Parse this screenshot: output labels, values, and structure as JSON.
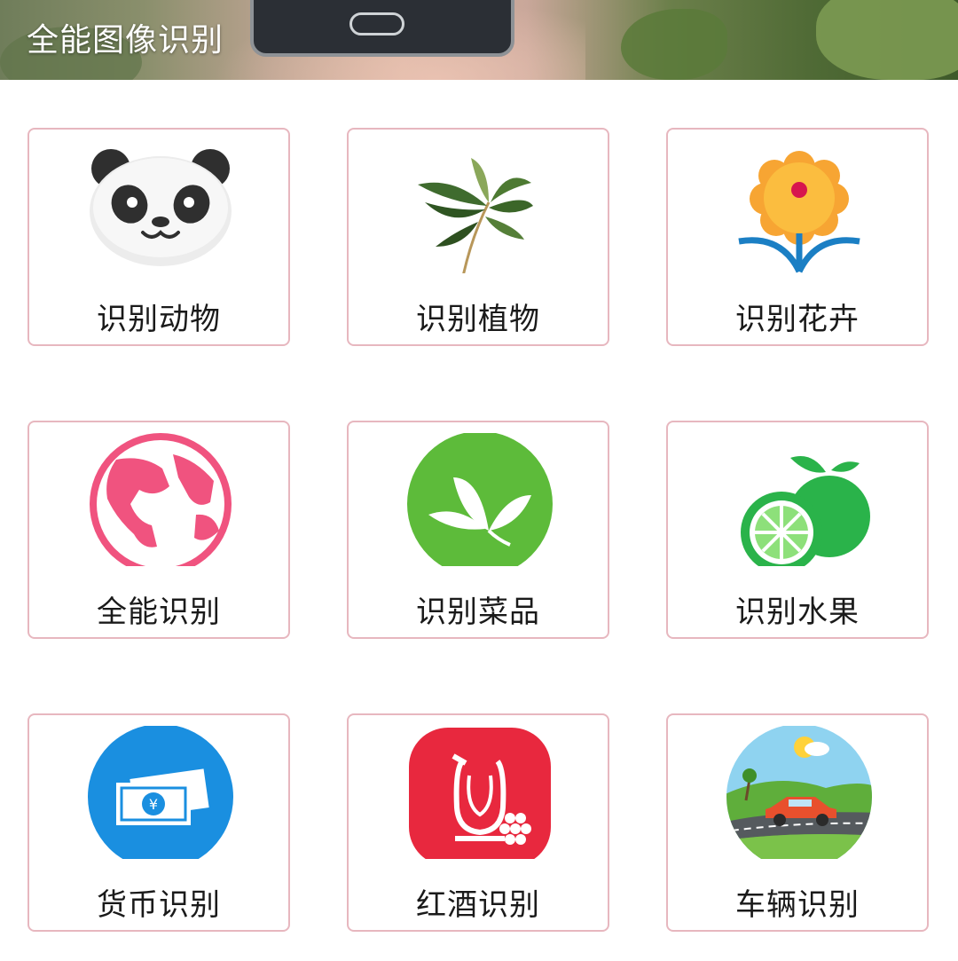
{
  "banner": {
    "title": "全能图像识别"
  },
  "cards": [
    {
      "label": "识别动物",
      "icon": "panda-icon"
    },
    {
      "label": "识别植物",
      "icon": "leaf-branch-icon"
    },
    {
      "label": "识别花卉",
      "icon": "flower-icon"
    },
    {
      "label": "全能识别",
      "icon": "globe-icon"
    },
    {
      "label": "识别菜品",
      "icon": "tea-leaf-icon"
    },
    {
      "label": "识别水果",
      "icon": "lime-fruit-icon"
    },
    {
      "label": "货币识别",
      "icon": "banknote-icon"
    },
    {
      "label": "红酒识别",
      "icon": "wine-decanter-icon"
    },
    {
      "label": "车辆识别",
      "icon": "car-landscape-icon"
    }
  ],
  "colors": {
    "card_border": "#e7b7bf",
    "globe": "#f0537f",
    "tea": "#5dbb3a",
    "lime": "#2ab34a",
    "money": "#1a8fe0",
    "wine": "#e8283e"
  }
}
